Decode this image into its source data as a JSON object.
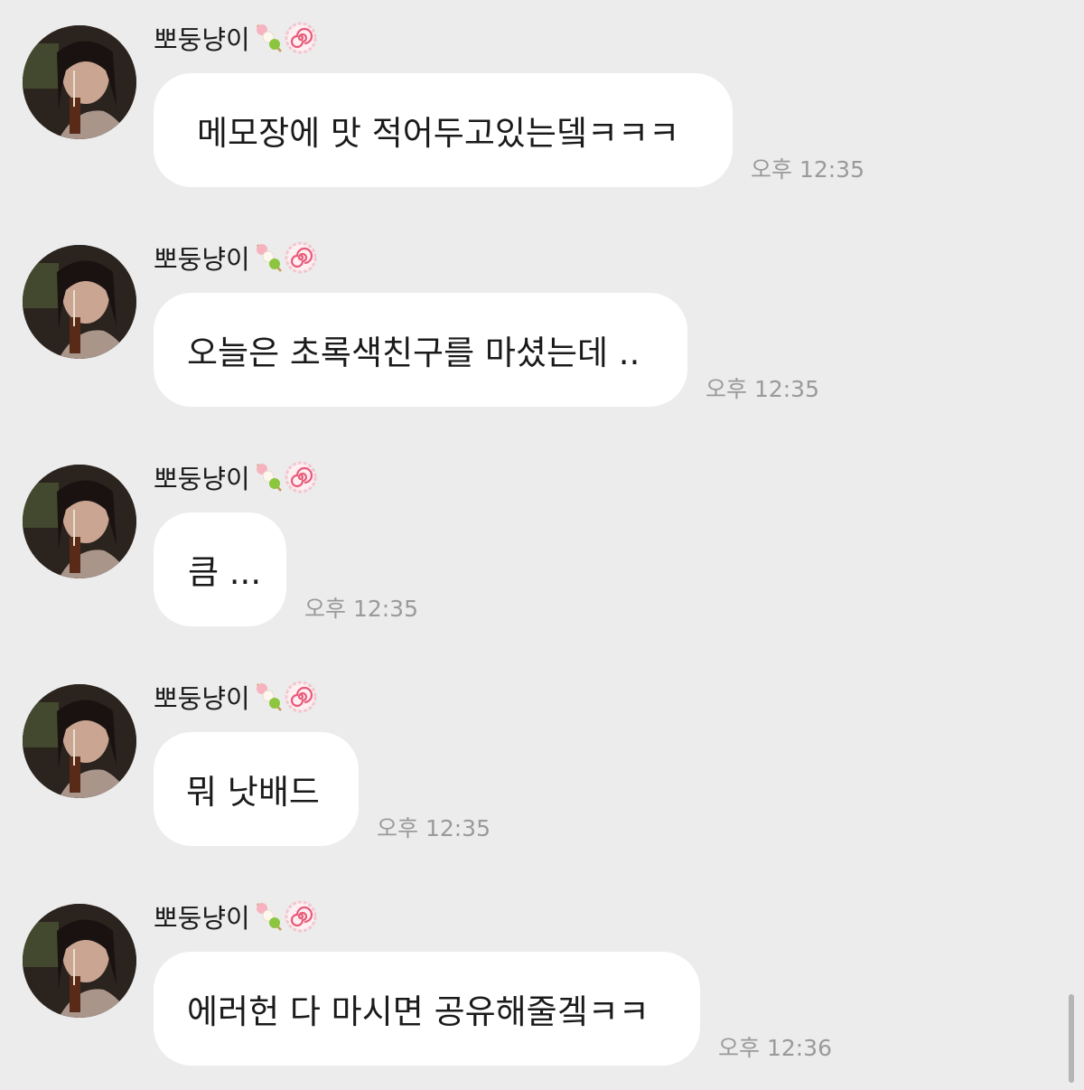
{
  "chat": {
    "messages": [
      {
        "sender": "뽀둥냥이",
        "sender_emojis": [
          "dango-icon",
          "narutomaki-icon"
        ],
        "text": "메모장에 맛 적어두고있는뎈ㅋㅋㅋ",
        "time": "오후 12:35"
      },
      {
        "sender": "뽀둥냥이",
        "sender_emojis": [
          "dango-icon",
          "narutomaki-icon"
        ],
        "text": "오늘은 초록색친구를 마셨는데 ..",
        "time": "오후 12:35"
      },
      {
        "sender": "뽀둥냥이",
        "sender_emojis": [
          "dango-icon",
          "narutomaki-icon"
        ],
        "text": "큼 ...",
        "time": "오후 12:35"
      },
      {
        "sender": "뽀둥냥이",
        "sender_emojis": [
          "dango-icon",
          "narutomaki-icon"
        ],
        "text": "뭐 낫배드",
        "time": "오후 12:35"
      },
      {
        "sender": "뽀둥냥이",
        "sender_emojis": [
          "dango-icon",
          "narutomaki-icon"
        ],
        "text": "에러헌 다 마시면 공유해줄겤ㅋㅋ",
        "time": "오후 12:36"
      }
    ]
  },
  "colors": {
    "background": "#ececec",
    "bubble": "#ffffff",
    "text": "#1a1a1a",
    "timestamp": "#9a9a9a"
  }
}
